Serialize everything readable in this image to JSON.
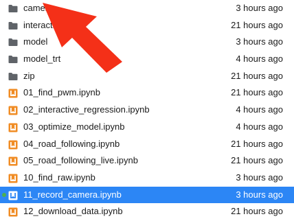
{
  "colors": {
    "selected_row": "#2c86f5",
    "notebook_icon": "#f08c24",
    "folder_icon": "#5f6368",
    "running_dot": "#4caf50",
    "annotation_arrow": "#f43018"
  },
  "files": [
    {
      "name": "camera",
      "modified": "3 hours ago",
      "icon": "folder-icon",
      "selected": false,
      "running": false
    },
    {
      "name": "interactive",
      "modified": "21 hours ago",
      "icon": "folder-icon",
      "selected": false,
      "running": false
    },
    {
      "name": "model",
      "modified": "3 hours ago",
      "icon": "folder-icon",
      "selected": false,
      "running": false
    },
    {
      "name": "model_trt",
      "modified": "4 hours ago",
      "icon": "folder-icon",
      "selected": false,
      "running": false
    },
    {
      "name": "zip",
      "modified": "21 hours ago",
      "icon": "folder-icon",
      "selected": false,
      "running": false
    },
    {
      "name": "01_find_pwm.ipynb",
      "modified": "21 hours ago",
      "icon": "notebook-icon",
      "selected": false,
      "running": false
    },
    {
      "name": "02_interactive_regression.ipynb",
      "modified": "4 hours ago",
      "icon": "notebook-icon",
      "selected": false,
      "running": false
    },
    {
      "name": "03_optimize_model.ipynb",
      "modified": "4 hours ago",
      "icon": "notebook-icon",
      "selected": false,
      "running": false
    },
    {
      "name": "04_road_following.ipynb",
      "modified": "21 hours ago",
      "icon": "notebook-icon",
      "selected": false,
      "running": false
    },
    {
      "name": "05_road_following_live.ipynb",
      "modified": "21 hours ago",
      "icon": "notebook-icon",
      "selected": false,
      "running": false
    },
    {
      "name": "10_find_raw.ipynb",
      "modified": "3 hours ago",
      "icon": "notebook-icon",
      "selected": false,
      "running": false
    },
    {
      "name": "11_record_camera.ipynb",
      "modified": "3 hours ago",
      "icon": "notebook-icon",
      "selected": true,
      "running": true
    },
    {
      "name": "12_download_data.ipynb",
      "modified": "21 hours ago",
      "icon": "notebook-icon",
      "selected": false,
      "running": false
    }
  ]
}
